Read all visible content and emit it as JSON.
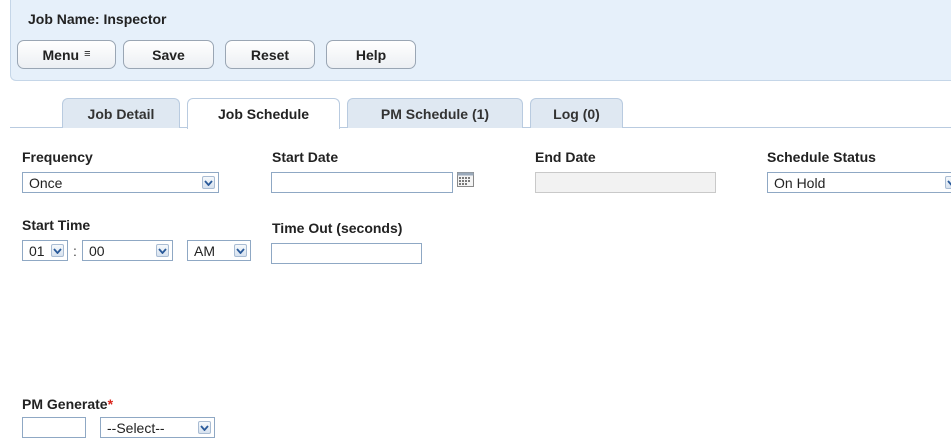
{
  "header": {
    "job_name": "Job Name: Inspector",
    "buttons": {
      "menu": "Menu",
      "menu_icon": "≡",
      "save": "Save",
      "reset": "Reset",
      "help": "Help"
    }
  },
  "tabs": [
    {
      "label": "Job Detail",
      "active": false
    },
    {
      "label": "Job Schedule",
      "active": true
    },
    {
      "label": "PM Schedule (1)",
      "active": false
    },
    {
      "label": "Log (0)",
      "active": false
    }
  ],
  "form": {
    "frequency": {
      "label": "Frequency",
      "value": "Once"
    },
    "start_date": {
      "label": "Start Date",
      "value": "",
      "icon": "calendar-icon"
    },
    "end_date": {
      "label": "End Date",
      "value": ""
    },
    "schedule_status": {
      "label": "Schedule Status",
      "value": "On Hold"
    },
    "start_time": {
      "label": "Start Time",
      "hour": "01",
      "separator": ":",
      "minute": "00",
      "ampm": "AM"
    },
    "time_out": {
      "label": "Time Out (seconds)",
      "value": ""
    },
    "pm_generate": {
      "label": "PM Generate",
      "required_mark": "*",
      "number": "",
      "unit": "--Select--"
    }
  },
  "colors": {
    "header_bg": "#e6f0fa",
    "tab_bg": "#dfe8f2",
    "border": "#8fa8c4",
    "required": "#d9241b"
  }
}
